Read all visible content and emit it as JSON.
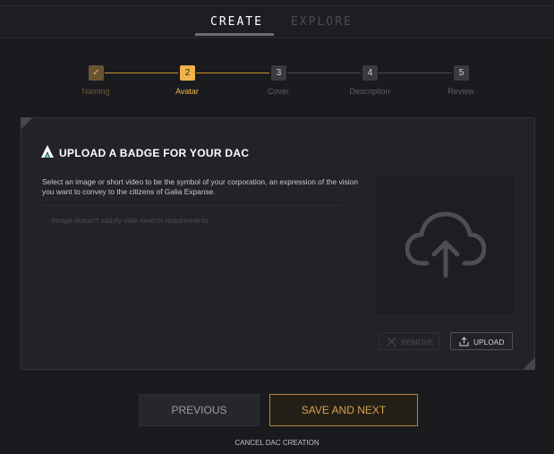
{
  "nav": {
    "tabs": [
      {
        "label": "CREATE",
        "active": true
      },
      {
        "label": "EXPLORE",
        "active": false
      }
    ]
  },
  "stepper": {
    "current_step": 2,
    "steps": [
      {
        "number": "✓",
        "label": "Naming",
        "state": "completed"
      },
      {
        "number": "2",
        "label": "Avatar",
        "state": "active"
      },
      {
        "number": "3",
        "label": "Cover",
        "state": "pending"
      },
      {
        "number": "4",
        "label": "Description",
        "state": "pending"
      },
      {
        "number": "5",
        "label": "Review",
        "state": "pending"
      }
    ]
  },
  "panel": {
    "title": "UPLOAD A BADGE FOR YOUR DAC",
    "description": "Select an image or short video to be the symbol of your corporation, an expression of the vision you want to convey to the citizens of Galia Expanse.",
    "warning": "Image doesn't satisfy safe search requirements",
    "warning_prefix": "···",
    "remove_label": "REMOVE",
    "upload_label": "UPLOAD"
  },
  "footer": {
    "previous_label": "PREVIOUS",
    "next_label": "SAVE AND NEXT",
    "cancel_label": "CANCEL DAC CREATION"
  },
  "colors": {
    "accent": "#f0b44a",
    "accent_muted": "#7a6233",
    "background": "#1a1b1f",
    "panel": "#222328"
  }
}
